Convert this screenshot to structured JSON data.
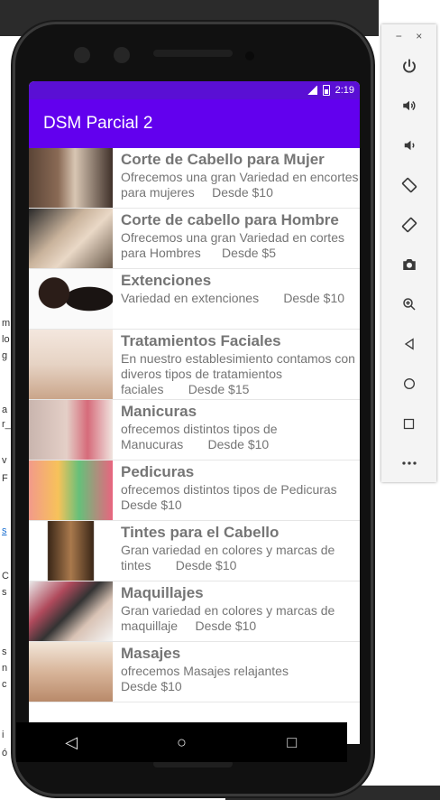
{
  "emulator": {
    "window_controls": {
      "minimize": "−",
      "close": "×"
    },
    "toolbar_icons": [
      "power-icon",
      "volume-up-icon",
      "volume-down-icon",
      "rotate-left-icon",
      "rotate-right-icon",
      "camera-icon",
      "zoom-icon",
      "back-icon",
      "home-icon",
      "overview-icon",
      "more-icon"
    ]
  },
  "status_bar": {
    "time": "2:19"
  },
  "app_bar": {
    "title": "DSM Parcial 2"
  },
  "services": [
    {
      "title": "Corte de Cabello para Mujer",
      "desc": "Ofrecemos una gran Variedad en encortes para mujeres",
      "price": "Desde $10"
    },
    {
      "title": "Corte de cabello para Hombre",
      "desc": "Ofrecemos una  gran Variedad en cortes para Hombres",
      "price": "Desde $5"
    },
    {
      "title": "Extenciones",
      "desc": "Variedad en extenciones",
      "price": "Desde $10"
    },
    {
      "title": "Tratamientos Faciales",
      "desc": "En nuestro establesimiento contamos con diveros tipos de tratamientos faciales",
      "price": "Desde $15"
    },
    {
      "title": "Manicuras",
      "desc": "ofrecemos distintos tipos de Manucuras",
      "price": "Desde $10"
    },
    {
      "title": "Pedicuras",
      "desc": "ofrecemos distintos tipos de Pedicuras",
      "price": "Desde $10"
    },
    {
      "title": "Tintes para el Cabello",
      "desc": "Gran variedad en colores y marcas de tintes",
      "price": "Desde $10"
    },
    {
      "title": "Maquillajes",
      "desc": "Gran variedad en colores y marcas de maquillaje",
      "price": "Desde $10"
    },
    {
      "title": "Masajes",
      "desc": "ofrecemos Masajes relajantes",
      "price": "Desde $10"
    }
  ],
  "nav_bar": {
    "back": "◁",
    "home": "○",
    "recents": "□"
  },
  "background_fragments": [
    "m",
    "lo",
    "g",
    "a",
    "r_",
    "v",
    "F",
    "s",
    "C",
    "s",
    "s",
    "n",
    "c",
    "i",
    "ó"
  ],
  "colors": {
    "status_bar": "#5a0fd4",
    "app_bar": "#6200ee"
  }
}
